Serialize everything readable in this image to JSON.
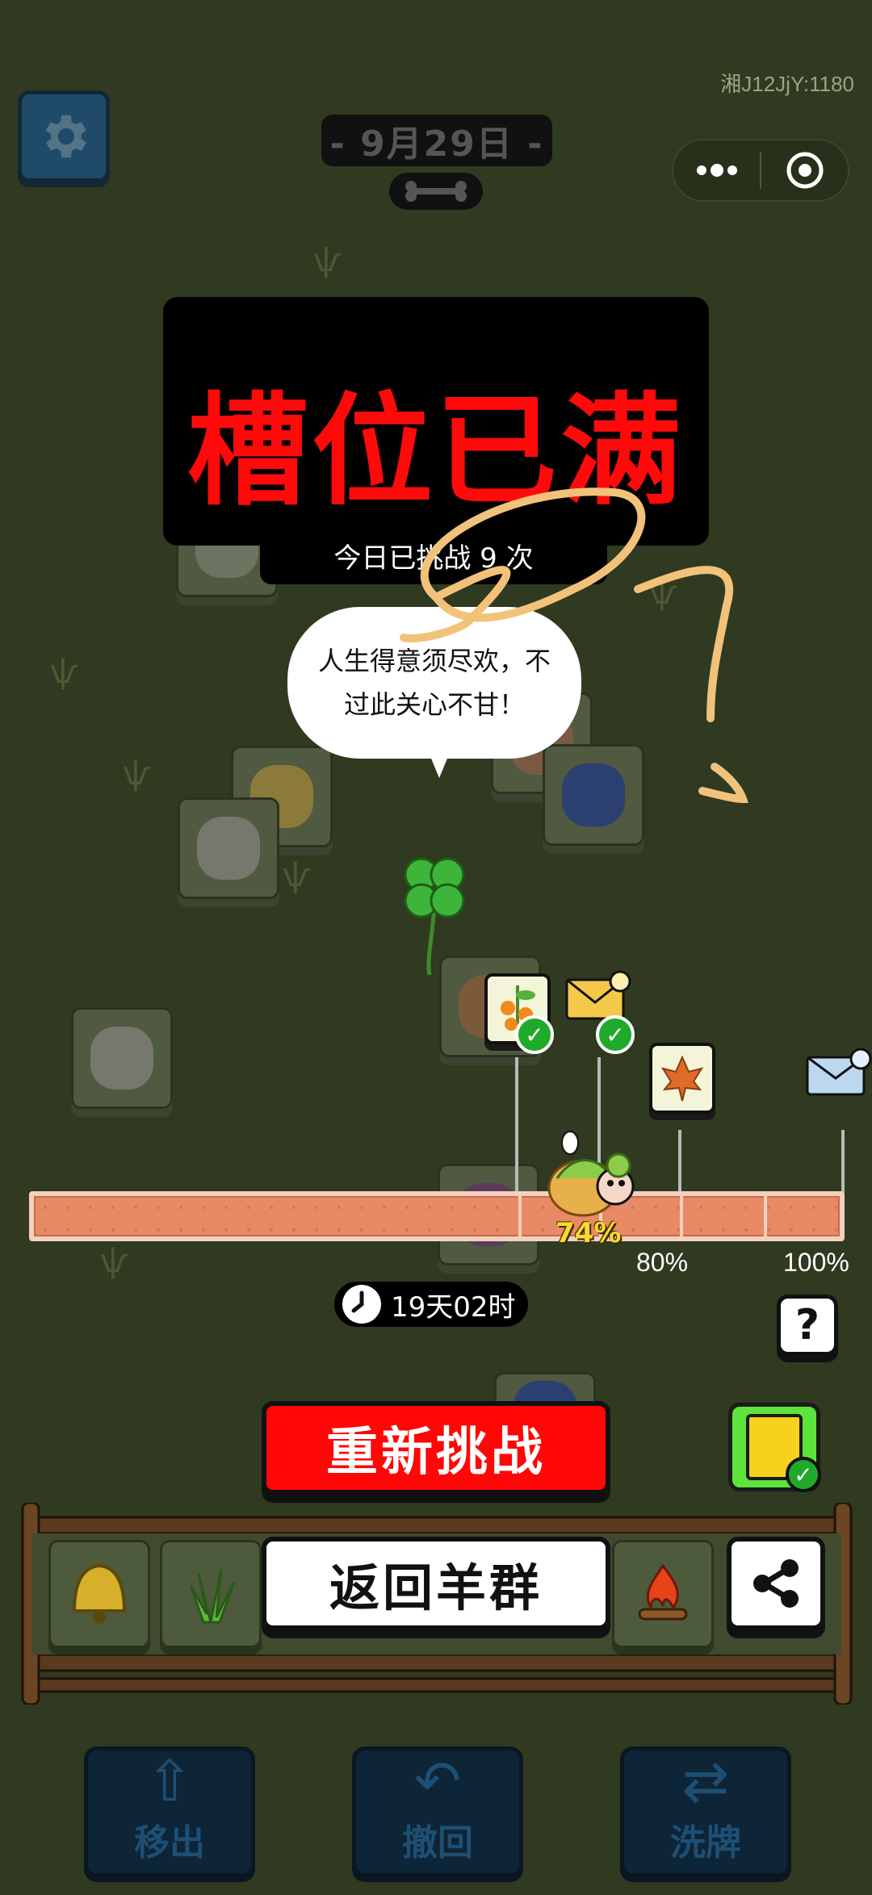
{
  "header": {
    "date": "- 9月29日 -",
    "version_text": "湘J12JjY:1180",
    "settings_icon": "gear-icon",
    "more_icon": "more-dots-icon",
    "close_icon": "target-circle-icon"
  },
  "panel": {
    "title": "槽位已满",
    "challenge_count": "今日已挑战 9 次"
  },
  "speech_bubble": {
    "line1": "人生得意须尽欢，不",
    "line2": "过此关心不甘！"
  },
  "progress": {
    "current_label": "74%",
    "current_value": 0.74,
    "milestone_80": "80%",
    "milestone_100": "100%"
  },
  "timer": {
    "text": "19天02时"
  },
  "help": {
    "label": "?"
  },
  "buttons": {
    "retry": "重新挑战",
    "back": "返回羊群"
  },
  "tools": {
    "move_out": "移出",
    "undo": "撤回",
    "shuffle": "洗牌"
  },
  "colors": {
    "background": "#2f3a20",
    "title_red": "#ff0a0a",
    "retry_red": "#ff0707",
    "progress_fill": "#e88a66",
    "tool_blue": "#0e2437"
  }
}
